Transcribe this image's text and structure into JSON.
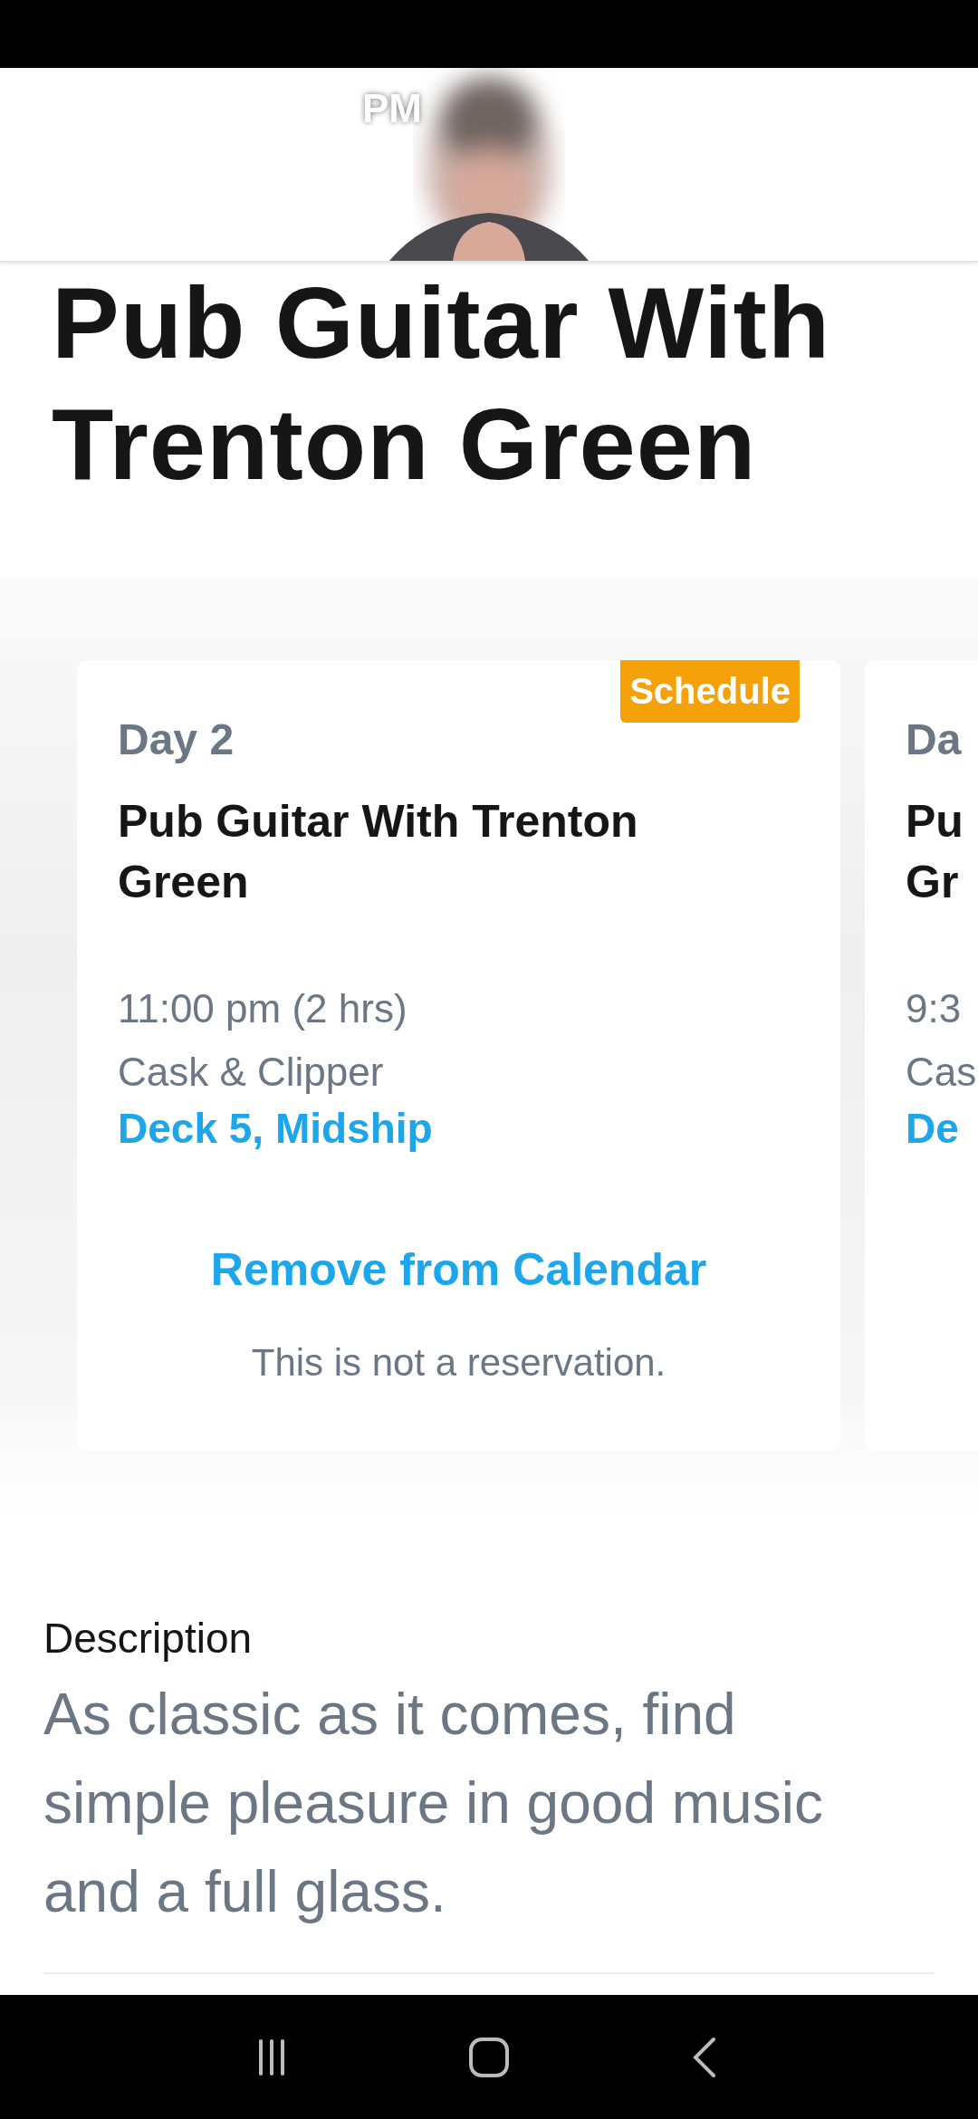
{
  "header": {
    "overlay_text": "PM"
  },
  "title": "Pub Guitar With Trenton Green",
  "cards": [
    {
      "badge": "Schedule",
      "day": "Day 2",
      "title": "Pub Guitar With Trenton Green",
      "time": "11:00 pm (2 hrs)",
      "venue": "Cask & Clipper",
      "location": "Deck 5, Midship",
      "action": "Remove from Calendar",
      "note": "This is not a reservation."
    },
    {
      "day": "Da",
      "title": "Pu",
      "title_line_2": "Gr",
      "time": "9:3",
      "venue": "Cas",
      "location": "De"
    }
  ],
  "description": {
    "heading": "Description",
    "text": "As classic as it comes, find simple pleasure in good music and a full glass."
  }
}
